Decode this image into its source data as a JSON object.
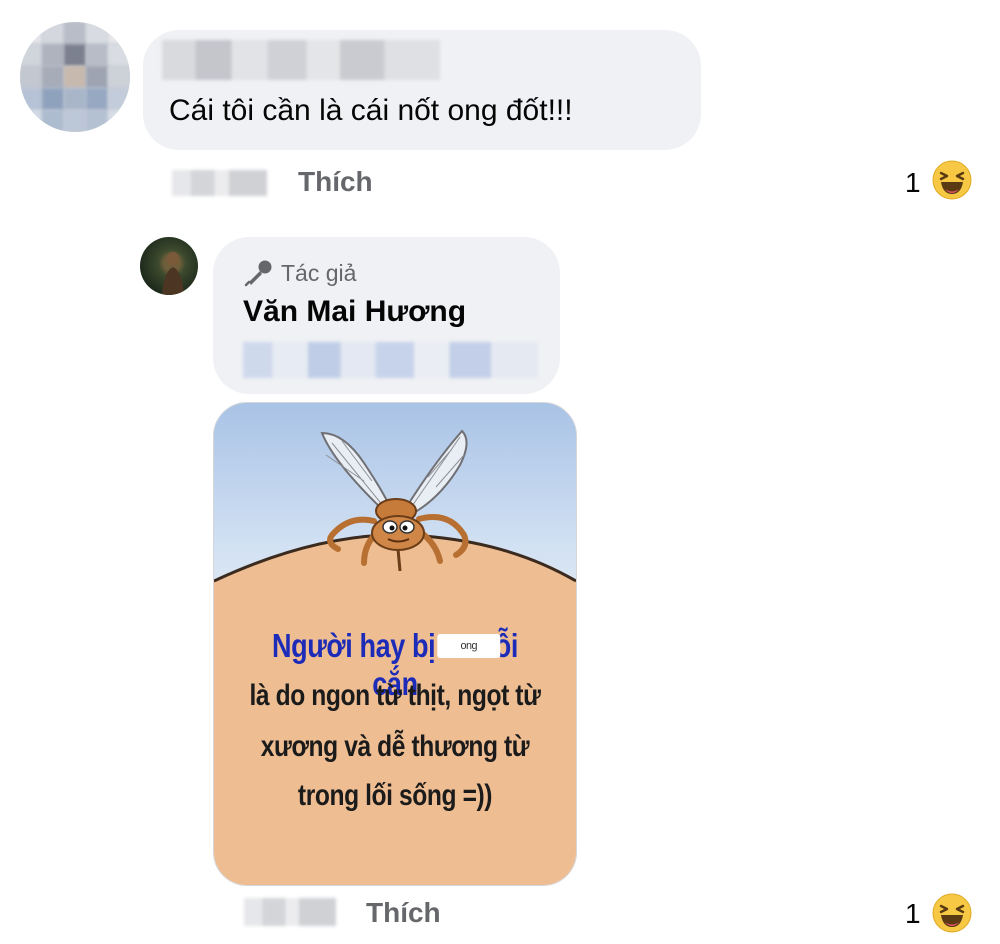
{
  "comment_1": {
    "text": "Cái tôi cần là cái nốt ong đốt!!!",
    "like_label": "Thích",
    "reaction_count": "1",
    "reaction_icon": "haha-emoji-icon"
  },
  "comment_2": {
    "author_badge": "Tác giả",
    "author_badge_icon": "microphone-icon",
    "author_name": "Văn Mai Hương",
    "like_label": "Thích",
    "reaction_count": "1",
    "reaction_icon": "haha-emoji-icon",
    "meme": {
      "line_1_before": "Người hay bị",
      "censor_text": "ong",
      "line_1_after": "ỗi cắn",
      "line_2": "là do ngon từ thịt, ngọt từ",
      "line_3": "xương và dễ thương từ",
      "line_4": "trong lối sống =))"
    }
  },
  "colors": {
    "bubble_bg": "#eff1f4",
    "meta_text": "#65676b",
    "meme_headline": "#1c2bb8",
    "meme_skin": "#eebd92",
    "haha_yellow": "#f7c843"
  }
}
